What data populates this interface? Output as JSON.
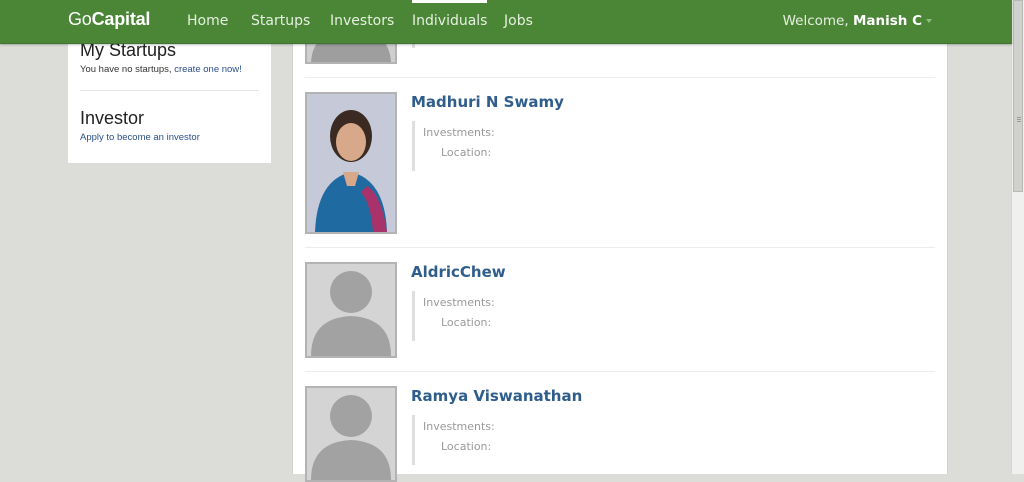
{
  "brand": {
    "part1": "Go",
    "part2": "Capital"
  },
  "nav": {
    "items": [
      "Home",
      "Startups",
      "Investors",
      "Individuals",
      "Jobs"
    ],
    "active": "Individuals"
  },
  "user": {
    "welcome": "Welcome,",
    "name": "Manish C"
  },
  "sidebar": {
    "startups_title": "My Startups",
    "startups_text": "You have no startups,",
    "startups_link": "create one now!",
    "investor_title": "Investor",
    "investor_link": "Apply to become an investor"
  },
  "people": [
    {
      "name": "Madhuri N Swamy",
      "investments_label": "Investments:",
      "location_label": "Location:",
      "photo": "portrait-photo"
    },
    {
      "name": "AldricChew",
      "investments_label": "Investments:",
      "location_label": "Location:",
      "photo": "default-avatar"
    },
    {
      "name": "Ramya Viswanathan",
      "investments_label": "Investments:",
      "location_label": "Location:",
      "photo": "default-avatar"
    }
  ],
  "colors": {
    "nav": "#4a8636",
    "link": "#2f5d8c",
    "background": "#dcdcd8"
  }
}
